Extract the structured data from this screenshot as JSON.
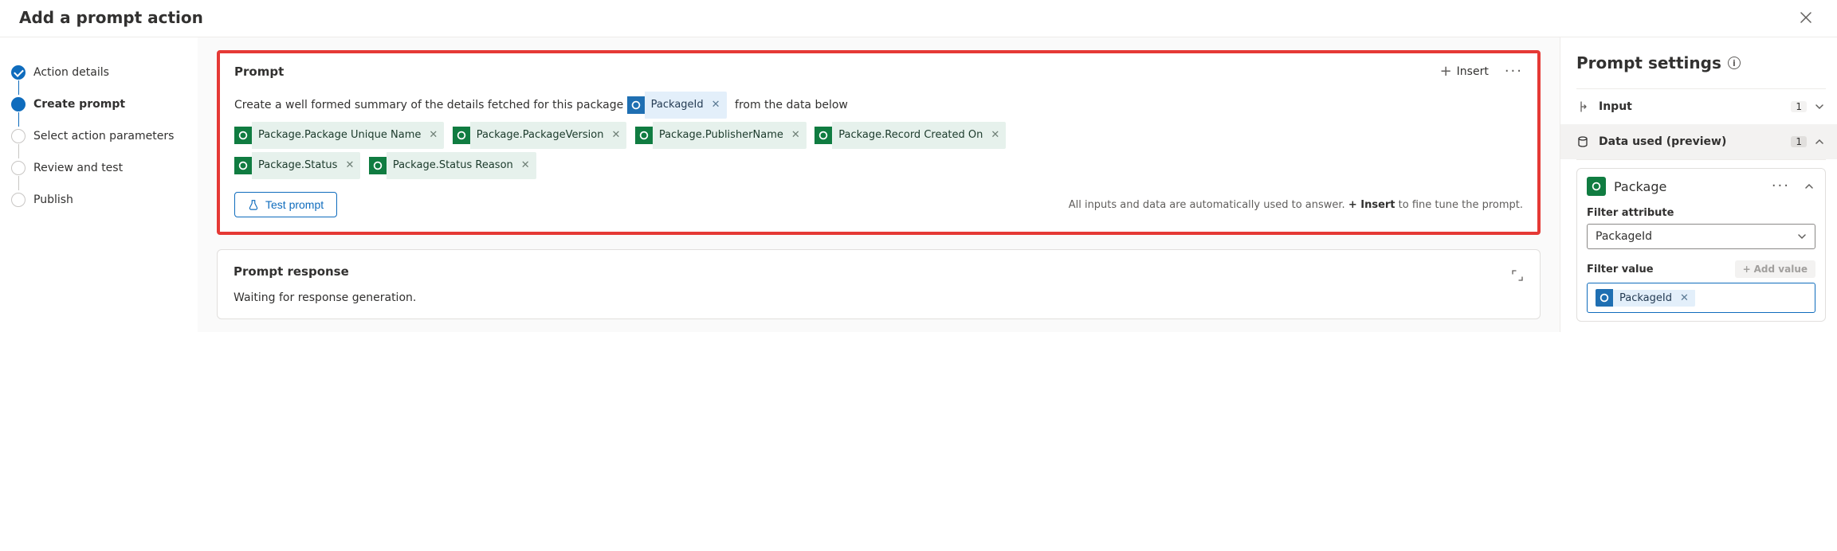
{
  "title": "Add a prompt action",
  "stepper": [
    {
      "label": "Action details",
      "state": "done"
    },
    {
      "label": "Create prompt",
      "state": "current"
    },
    {
      "label": "Select action parameters",
      "state": "todo"
    },
    {
      "label": "Review and test",
      "state": "todo"
    },
    {
      "label": "Publish",
      "state": "todo"
    }
  ],
  "prompt": {
    "heading": "Prompt",
    "insert_label": "Insert",
    "text_before": "Create a well formed summary of the details fetched for this package",
    "text_after": "from the data below",
    "inline_token": {
      "label": "PackageId",
      "kind": "blue"
    },
    "tokens_line2": [
      "Package.Package Unique Name",
      "Package.PackageVersion",
      "Package.PublisherName",
      "Package.Record Created On"
    ],
    "tokens_line3": [
      "Package.Status",
      "Package.Status Reason"
    ],
    "test_btn": "Test prompt",
    "helper_pre": "All inputs and data are automatically used to answer. ",
    "helper_bold": "+ Insert",
    "helper_post": " to fine tune the prompt."
  },
  "response": {
    "heading": "Prompt response",
    "body": "Waiting for response generation."
  },
  "settings": {
    "title": "Prompt settings",
    "input": {
      "label": "Input",
      "count": "1"
    },
    "data": {
      "label": "Data used (preview)",
      "count": "1",
      "entity": "Package",
      "filter_attr_label": "Filter attribute",
      "filter_attr_value": "PackageId",
      "filter_val_label": "Filter value",
      "add_value": "Add value",
      "filter_val_chip": "PackageId"
    }
  }
}
